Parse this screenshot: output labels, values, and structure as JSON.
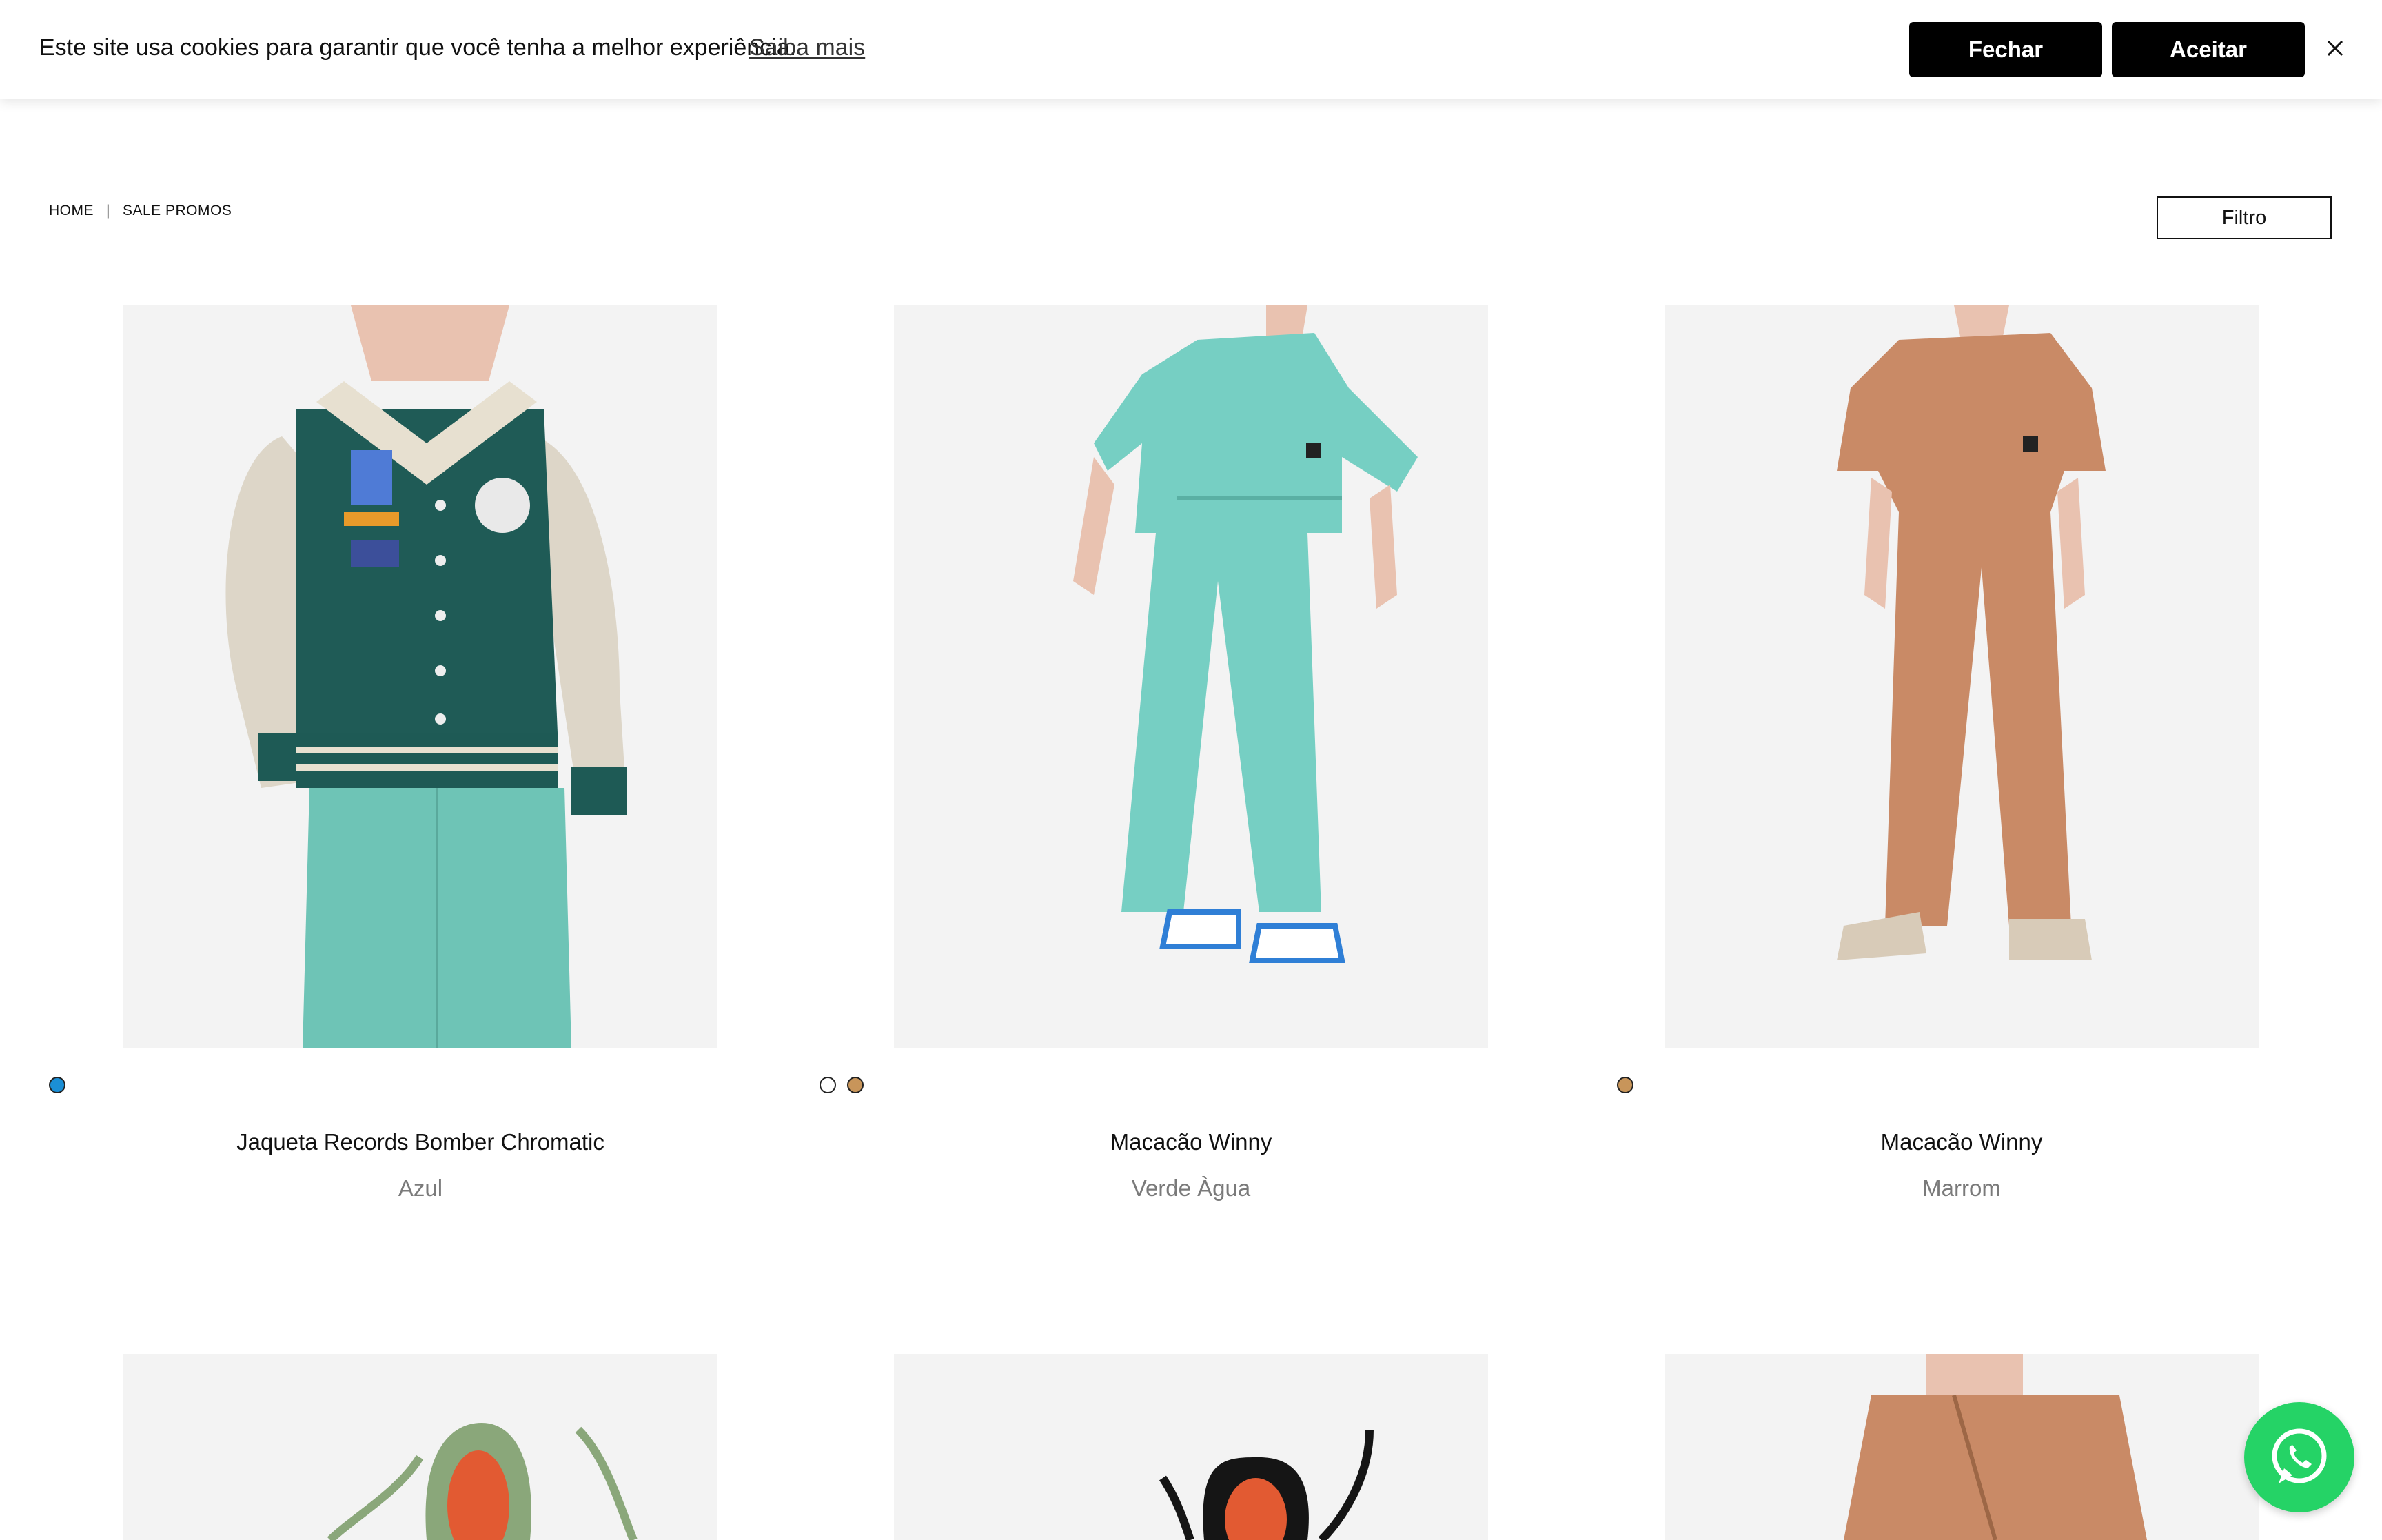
{
  "cookie": {
    "message": "Este site usa cookies para garantir que você tenha a melhor experiência.",
    "learn_more": "Saiba mais",
    "close_label": "Fechar",
    "accept_label": "Aceitar"
  },
  "breadcrumb": {
    "home": "HOME",
    "separator": "|",
    "current": "SALE PROMOS"
  },
  "filter": {
    "label": "Filtro"
  },
  "products": [
    {
      "name": "Jaqueta Records Bomber Chromatic",
      "color": "Azul",
      "swatches": [
        "#1b8fd6"
      ]
    },
    {
      "name": "Macacão Winny",
      "color": "Verde Àgua",
      "swatches": [
        "#ffffff",
        "#c8955a"
      ]
    },
    {
      "name": "Macacão Winny",
      "color": "Marrom",
      "swatches": [
        "#c8955a"
      ]
    }
  ],
  "colors": {
    "whatsapp": "#25d366",
    "button_bg": "#000000",
    "image_bg": "#f3f3f3"
  }
}
